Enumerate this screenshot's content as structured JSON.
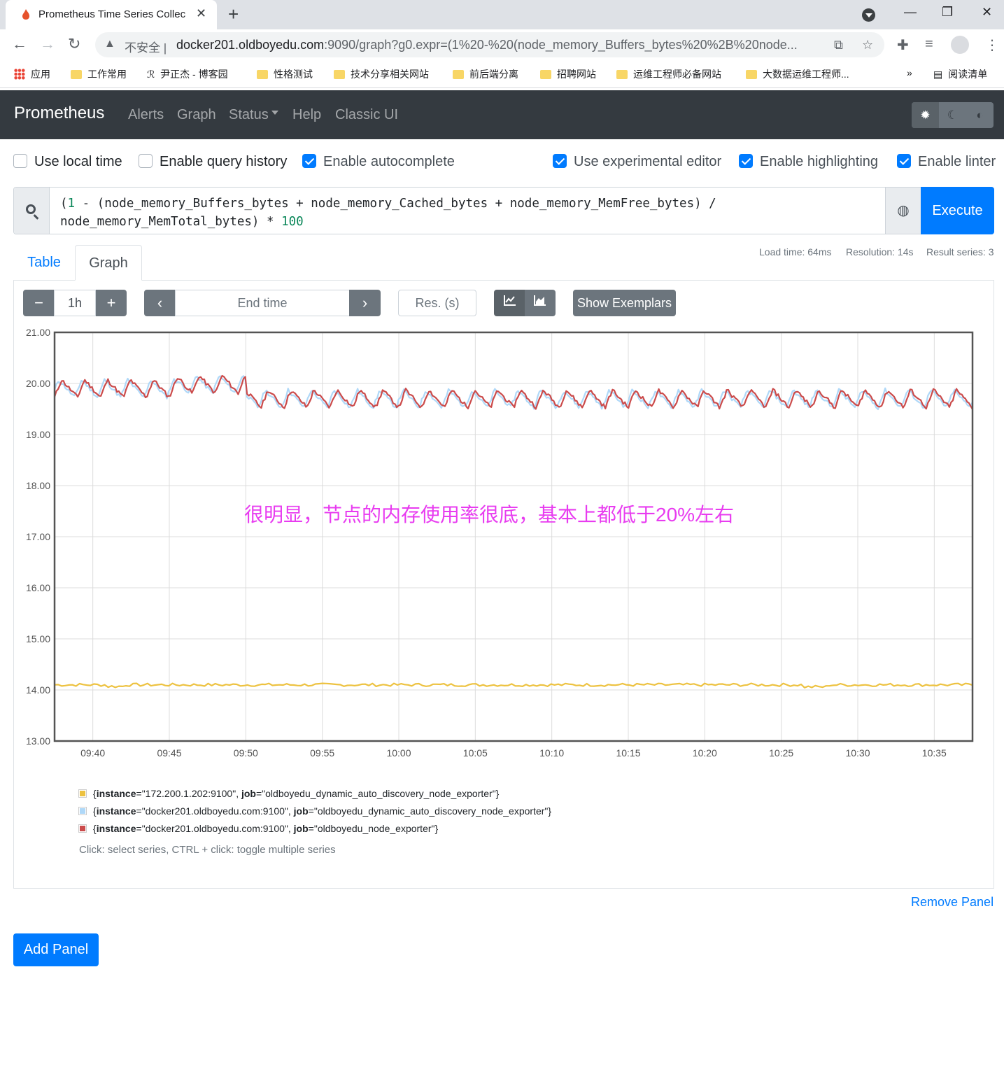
{
  "browser": {
    "tab_title": "Prometheus Time Series Collec",
    "insecure_label": "不安全",
    "url_host": "docker201.oldboyedu.com",
    "url_path": ":9090/graph?g0.expr=(1%20-%20(node_memory_Buffers_bytes%20%2B%20node...",
    "bookmarks": [
      "应用",
      "工作常用",
      "尹正杰 - 博客园",
      "性格测试",
      "技术分享相关网站",
      "前后端分离",
      "招聘网站",
      "运维工程师必备网站",
      "大数据运维工程师..."
    ],
    "overflow": "»",
    "reading_list": "阅读清单"
  },
  "nav": {
    "brand": "Prometheus",
    "links": [
      "Alerts",
      "Graph",
      "Status",
      "Help",
      "Classic UI"
    ]
  },
  "options": [
    {
      "label": "Use local time",
      "checked": false
    },
    {
      "label": "Enable query history",
      "checked": false
    },
    {
      "label": "Enable autocomplete",
      "checked": true
    },
    {
      "label": "Use experimental editor",
      "checked": true
    },
    {
      "label": "Enable highlighting",
      "checked": true
    },
    {
      "label": "Enable linter",
      "checked": true
    }
  ],
  "query": {
    "line1": "(1 - (node_memory_Buffers_bytes + node_memory_Cached_bytes + node_memory_MemFree_bytes) /",
    "line2": "node_memory_MemTotal_bytes) * 100",
    "execute": "Execute"
  },
  "tabs": {
    "table": "Table",
    "graph": "Graph"
  },
  "stats": {
    "load": "Load time: 64ms",
    "resolution": "Resolution: 14s",
    "series": "Result series: 3"
  },
  "controls": {
    "range": "1h",
    "end_time_placeholder": "End time",
    "res_placeholder": "Res. (s)",
    "show_exemplars": "Show Exemplars"
  },
  "annotation": "很明显，节点的内存使用率很底，基本上都低于20%左右",
  "chart_data": {
    "type": "line",
    "ylim": [
      13,
      21
    ],
    "yticks": [
      "13.00",
      "14.00",
      "15.00",
      "16.00",
      "17.00",
      "18.00",
      "19.00",
      "20.00",
      "21.00"
    ],
    "xlim": [
      "09:37:30",
      "09:37:30+60min"
    ],
    "xticks": [
      "09:40",
      "09:45",
      "09:50",
      "09:55",
      "10:00",
      "10:05",
      "10:10",
      "10:15",
      "10:20",
      "10:25",
      "10:30",
      "10:35"
    ],
    "series": [
      {
        "name": "{instance=\"172.200.1.202:9100\", job=\"oldboyedu_dynamic_auto_discovery_node_exporter\"}",
        "color": "#edc240",
        "approx_value": 14.1,
        "jitter": 0.03
      },
      {
        "name": "{instance=\"docker201.oldboyedu.com:9100\", job=\"oldboyedu_dynamic_auto_discovery_node_exporter\"}",
        "color": "#afd8f8",
        "approx_value_before_0950": 19.9,
        "approx_value_after_0950": 19.7,
        "oscillation": 0.35
      },
      {
        "name": "{instance=\"docker201.oldboyedu.com:9100\", job=\"oldboyedu_node_exporter\"}",
        "color": "#cb4b4b",
        "approx_value_before_0950": 19.9,
        "approx_value_after_0950": 19.7,
        "oscillation": 0.35
      }
    ]
  },
  "legend": [
    {
      "color": "#edc240",
      "instance": "\"172.200.1.202:9100\"",
      "job": "\"oldboyedu_dynamic_auto_discovery_node_exporter\"}"
    },
    {
      "color": "#afd8f8",
      "instance": "\"docker201.oldboyedu.com:9100\"",
      "job": "\"oldboyedu_dynamic_auto_discovery_node_exporter\"}"
    },
    {
      "color": "#cb4b4b",
      "instance": "\"docker201.oldboyedu.com:9100\"",
      "job": "\"oldboyedu_node_exporter\"}"
    }
  ],
  "legend_hint": "Click: select series, CTRL + click: toggle multiple series",
  "remove_panel": "Remove Panel",
  "add_panel": "Add Panel"
}
